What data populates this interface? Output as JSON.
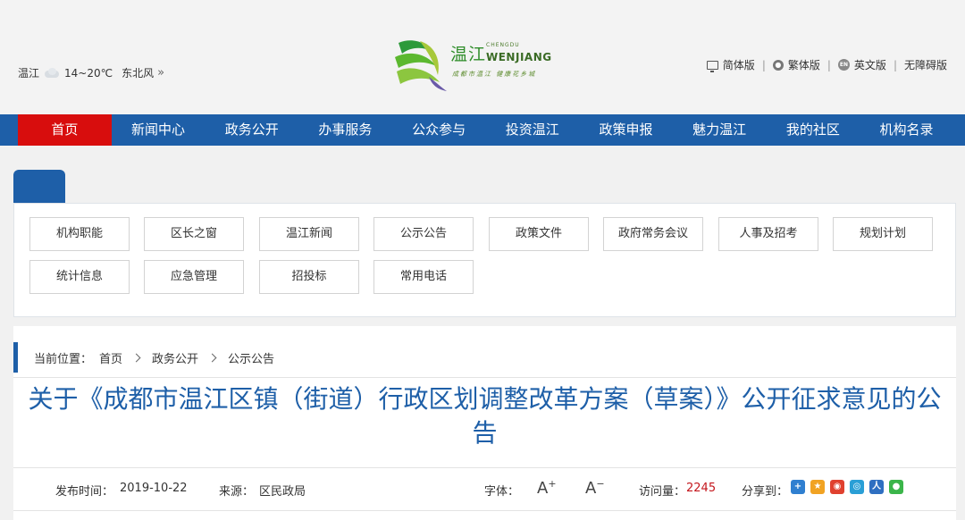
{
  "weather": {
    "city": "温江",
    "temp": "14~20℃",
    "wind": "东北风",
    "more": "»"
  },
  "logo": {
    "cn_name": "温江",
    "en_small": "CHENGDU",
    "en_big": "WENJIANG",
    "slogan": "成都市温江 健康花乡城"
  },
  "versions": {
    "simplified": "简体版",
    "traditional": "繁体版",
    "english": "英文版",
    "accessible": "无障碍版",
    "en_badge": "EN",
    "sep": "|"
  },
  "nav": [
    "首页",
    "新闻中心",
    "政务公开",
    "办事服务",
    "公众参与",
    "投资温江",
    "政策申报",
    "魅力温江",
    "我的社区",
    "机构名录"
  ],
  "categories": [
    "机构职能",
    "区长之窗",
    "温江新闻",
    "公示公告",
    "政策文件",
    "政府常务会议",
    "人事及招考",
    "规划计划",
    "统计信息",
    "应急管理",
    "招投标",
    "常用电话"
  ],
  "breadcrumb": {
    "label": "当前位置：",
    "items": [
      "首页",
      "政务公开",
      "公示公告"
    ]
  },
  "article": {
    "title": "关于《成都市温江区镇（街道）行政区划调整改革方案（草案）》公开征求意见的公告",
    "date_label": "发布时间：",
    "date": "2019-10-22",
    "source_label": "来源：",
    "source": "区民政局",
    "font_label": "字体：",
    "font_large": "A",
    "font_small": "A",
    "visits_label": "访问量：",
    "visits": "2245",
    "share_label": "分享到："
  },
  "colors": {
    "nav_blue": "#1e5fa8",
    "nav_active": "#d80d0d",
    "title_blue": "#1e5fa8"
  }
}
